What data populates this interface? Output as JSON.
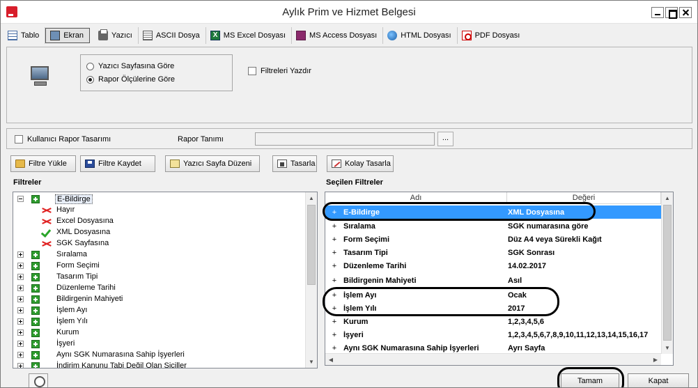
{
  "window": {
    "title": "Aylık Prim ve Hizmet Belgesi"
  },
  "tabs": [
    {
      "label": "Tablo",
      "icon": "table-icon"
    },
    {
      "label": "Ekran",
      "icon": "screen-icon"
    },
    {
      "label": "Yazıcı",
      "icon": "printer-icon"
    },
    {
      "label": "ASCII Dosya",
      "icon": "ascii-file-icon"
    },
    {
      "label": "MS Excel Dosyası",
      "icon": "excel-icon"
    },
    {
      "label": "MS Access Dosyası",
      "icon": "access-icon"
    },
    {
      "label": "HTML Dosyası",
      "icon": "globe-icon"
    },
    {
      "label": "PDF Dosyası",
      "icon": "pdf-icon"
    }
  ],
  "options": {
    "radio_page": "Yazıcı Sayfasına Göre",
    "radio_report": "Rapor Ölçülerine Göre",
    "selected_radio": "radio_report",
    "print_filters": "Filtreleri Yazdır",
    "print_filters_checked": false
  },
  "rapor": {
    "user_design": "Kullanıcı Rapor Tasarımı",
    "user_design_checked": false,
    "definition_label": "Rapor Tanımı",
    "definition_value": "",
    "browse_label": "..."
  },
  "toolbar": {
    "load_filter": "Filtre Yükle",
    "save_filter": "Filtre Kaydet",
    "page_setup": "Yazıcı Sayfa Düzeni",
    "design": "Tasarla",
    "easy_design": "Kolay Tasarla"
  },
  "tree": {
    "title": "Filtreler",
    "root": "E-Bildirge",
    "children": [
      {
        "label": "Hayır",
        "state": "cross"
      },
      {
        "label": "Excel Dosyasına",
        "state": "cross"
      },
      {
        "label": "XML Dosyasına",
        "state": "check"
      },
      {
        "label": "SGK Sayfasına",
        "state": "cross"
      }
    ],
    "nodes": [
      "Sıralama",
      "Form Seçimi",
      "Tasarım Tipi",
      "Düzenleme Tarihi",
      "Bildirgenin Mahiyeti",
      "İşlem Ayı",
      "İşlem Yılı",
      "Kurum",
      "İşyeri",
      "Aynı SGK Numarasına Sahip İşyerleri",
      "İndirim Kanunu Tabi Değil Olan Siciller"
    ]
  },
  "grid": {
    "title": "Seçilen Filtreler",
    "col_name": "Adı",
    "col_value": "Değeri",
    "rows": [
      {
        "name": "E-Bildirge",
        "value": "XML Dosyasına"
      },
      {
        "name": "Sıralama",
        "value": "SGK numarasına göre"
      },
      {
        "name": "Form Seçimi",
        "value": "Düz A4 veya Sürekli Kağıt"
      },
      {
        "name": "Tasarım Tipi",
        "value": "SGK Sonrası"
      },
      {
        "name": "Düzenleme Tarihi",
        "value": "14.02.2017"
      },
      {
        "name": "Bildirgenin Mahiyeti",
        "value": "Asıl"
      },
      {
        "name": "İşlem Ayı",
        "value": "Ocak"
      },
      {
        "name": "İşlem Yılı",
        "value": "2017"
      },
      {
        "name": "Kurum",
        "value": "1,2,3,4,5,6"
      },
      {
        "name": "İşyeri",
        "value": "1,2,3,4,5,6,7,8,9,10,11,12,13,14,15,16,17"
      },
      {
        "name": "Aynı SGK Numarasına Sahip İşyerleri",
        "value": "Ayrı Sayfa"
      }
    ]
  },
  "footer": {
    "ok": "Tamam",
    "close": "Kapat"
  },
  "colors": {
    "selection": "#3399ff",
    "check_green": "#2aa52a",
    "cross_red": "#e02020"
  }
}
